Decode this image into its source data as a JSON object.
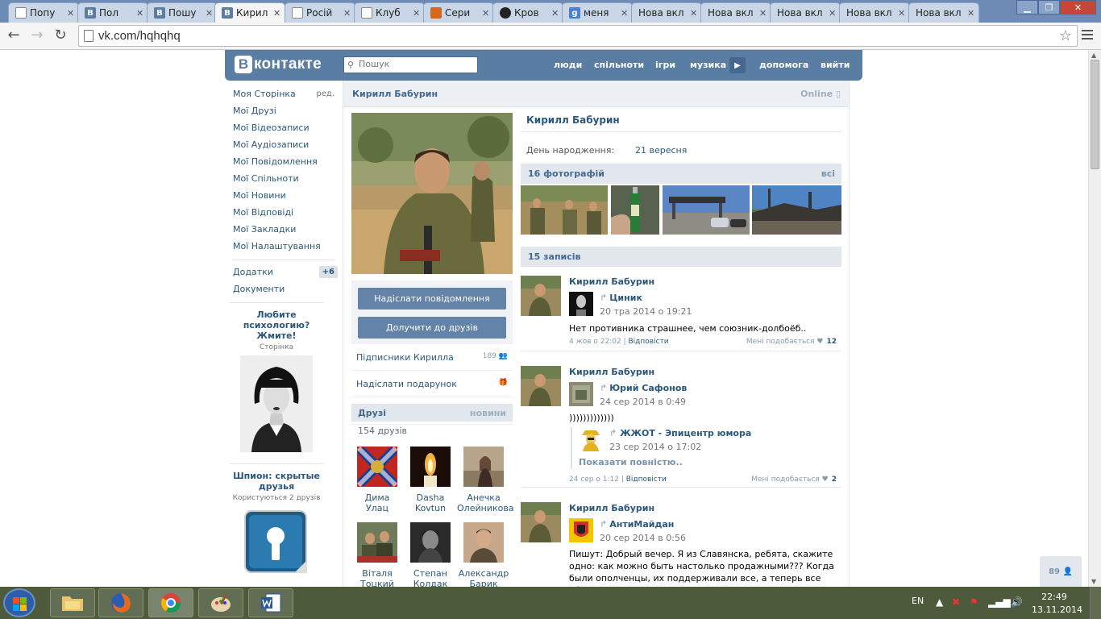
{
  "browser": {
    "tabs": [
      {
        "label": "Попу",
        "icon": "page",
        "active": false
      },
      {
        "label": "Пол",
        "icon": "vk",
        "active": false
      },
      {
        "label": "Пошу",
        "icon": "vk",
        "active": false
      },
      {
        "label": "Кирил",
        "icon": "vk",
        "active": true
      },
      {
        "label": "Росій",
        "icon": "page",
        "active": false
      },
      {
        "label": "Клуб",
        "icon": "page",
        "active": false
      },
      {
        "label": "Сери",
        "icon": "squirrel",
        "active": false
      },
      {
        "label": "Кров",
        "icon": "skull",
        "active": false
      },
      {
        "label": "меня",
        "icon": "google",
        "active": false
      },
      {
        "label": "Нова вкл",
        "icon": "none",
        "active": false
      },
      {
        "label": "Нова вкл",
        "icon": "none",
        "active": false
      },
      {
        "label": "Нова вкл",
        "icon": "none",
        "active": false
      },
      {
        "label": "Нова вкл",
        "icon": "none",
        "active": false
      },
      {
        "label": "Нова вкл",
        "icon": "none",
        "active": false
      }
    ],
    "url": "vk.com/hqhqhq"
  },
  "header": {
    "logo_letter": "В",
    "logo_text": "контакте",
    "search_placeholder": "Пошук",
    "nav": [
      "люди",
      "спільноти",
      "ігри",
      "музика",
      "допомога",
      "вийти"
    ]
  },
  "sidebar": {
    "items": [
      {
        "label": "Моя Сторінка",
        "extra": "ред."
      },
      {
        "label": "Мої Друзі"
      },
      {
        "label": "Мої Відеозаписи"
      },
      {
        "label": "Мої Аудіозаписи"
      },
      {
        "label": "Мої Повідомлення"
      },
      {
        "label": "Мої Спільноти"
      },
      {
        "label": "Мої Новини"
      },
      {
        "label": "Мої Відповіді"
      },
      {
        "label": "Мої Закладки"
      },
      {
        "label": "Мої Налаштування"
      }
    ],
    "apps": [
      {
        "label": "Додатки",
        "badge": "+6"
      },
      {
        "label": "Документи"
      }
    ],
    "ads": [
      {
        "title": "Любите психологию? Жмите!",
        "sub": "Сторінка"
      },
      {
        "title": "Шпион: скрытые друзья",
        "sub": "Користуються 2 друзів"
      }
    ]
  },
  "profile": {
    "title_name": "Кирилл Бабурин",
    "online": "Online",
    "name": "Кирилл Бабурин",
    "birthday_label": "День народження:",
    "birthday_value": "21 вересня",
    "btn_message": "Надіслати повідомлення",
    "btn_add": "Долучити до друзів",
    "followers_label": "Підписники Кирилла",
    "followers_count": "189",
    "gift_label": "Надіслати подарунок",
    "friends_header": "Друзі",
    "friends_news": "новини",
    "friends_count": "154 друзів",
    "friends": [
      {
        "first": "Дима",
        "last": "Улац"
      },
      {
        "first": "Dasha",
        "last": "Kovtun"
      },
      {
        "first": "Анечка",
        "last": "Олейникова"
      },
      {
        "first": "Віталя",
        "last": "Тоцкий"
      },
      {
        "first": "Степан",
        "last": "Колдак"
      },
      {
        "first": "Александр",
        "last": "Барик"
      }
    ],
    "photos_header": "16 фотографій",
    "photos_all": "всі",
    "wall_header": "15 записів"
  },
  "posts": [
    {
      "author": "Кирилл Бабурин",
      "repost_name": "Циник",
      "repost_date": "20 тра 2014 о 19:21",
      "text": "Нет противника страшнее, чем союзник-долбоёб..",
      "date": "4 жов о 22:02",
      "reply": "Відповісти",
      "like_label": "Мені подобається",
      "likes": "12"
    },
    {
      "author": "Кирилл Бабурин",
      "repost_name": "Юрий Сафонов",
      "repost_date": "24 сер 2014 в 0:49",
      "text": ")))))))))))))",
      "nested_name": "ЖЖОТ - Эпицентр юмора",
      "nested_date": "23 сер 2014 о 17:02",
      "more": "Показати повністю..",
      "date": "24 сер о 1:12",
      "reply": "Відповісти",
      "like_label": "Мені подобається",
      "likes": "2"
    },
    {
      "author": "Кирилл Бабурин",
      "repost_name": "АнтиМайдан",
      "repost_date": "20 сер 2014 в 0:56",
      "text": "Пишут: Добрый вечер. Я из Славянска, ребята, скажите одно: как можно быть настолько продажными??? Когда были ополченцы, их поддерживали все, а теперь все обещались"
    }
  ],
  "counter": "89",
  "taskbar": {
    "lang": "EN",
    "time": "22:49",
    "date": "13.11.2014"
  },
  "colors": {
    "vk_blue": "#597da3",
    "link": "#2b587a",
    "tab_strip": "#6d8bb5"
  }
}
